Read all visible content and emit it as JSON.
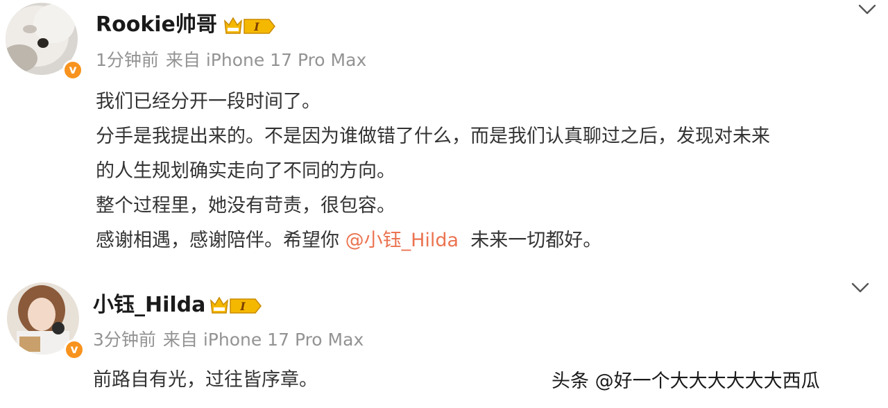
{
  "posts": [
    {
      "username": "Rookie帅哥",
      "level_badge": "I",
      "time": "1分钟前",
      "source": "来自 iPhone 17 Pro Max",
      "verified_mark": "v",
      "lines": [
        "我们已经分开一段时间了。",
        "分手是我提出来的。不是因为谁做错了什么，而是我们认真聊过之后，发现对未来",
        "的人生规划确实走向了不同的方向。",
        "整个过程里，她没有苛责，很包容。"
      ],
      "last_line_before": "感谢相遇，感谢陪伴。希望你 ",
      "mention": "@小钰_Hilda",
      "last_line_after": "  未来一切都好。"
    },
    {
      "username": "小钰_Hilda",
      "level_badge": "I",
      "time": "3分钟前",
      "source": "来自 iPhone 17 Pro Max",
      "verified_mark": "v",
      "lines": [
        "前路自有光，过往皆序章。"
      ]
    }
  ],
  "watermark": "头条 @好一个大大大大大大西瓜",
  "colors": {
    "mention": "#eb7350",
    "meta": "#939393",
    "verified": "#f7931e",
    "badge": "#f5b800"
  },
  "icons": [
    "chevron-down-icon",
    "crown-level-badge-icon",
    "verified-v-icon"
  ]
}
